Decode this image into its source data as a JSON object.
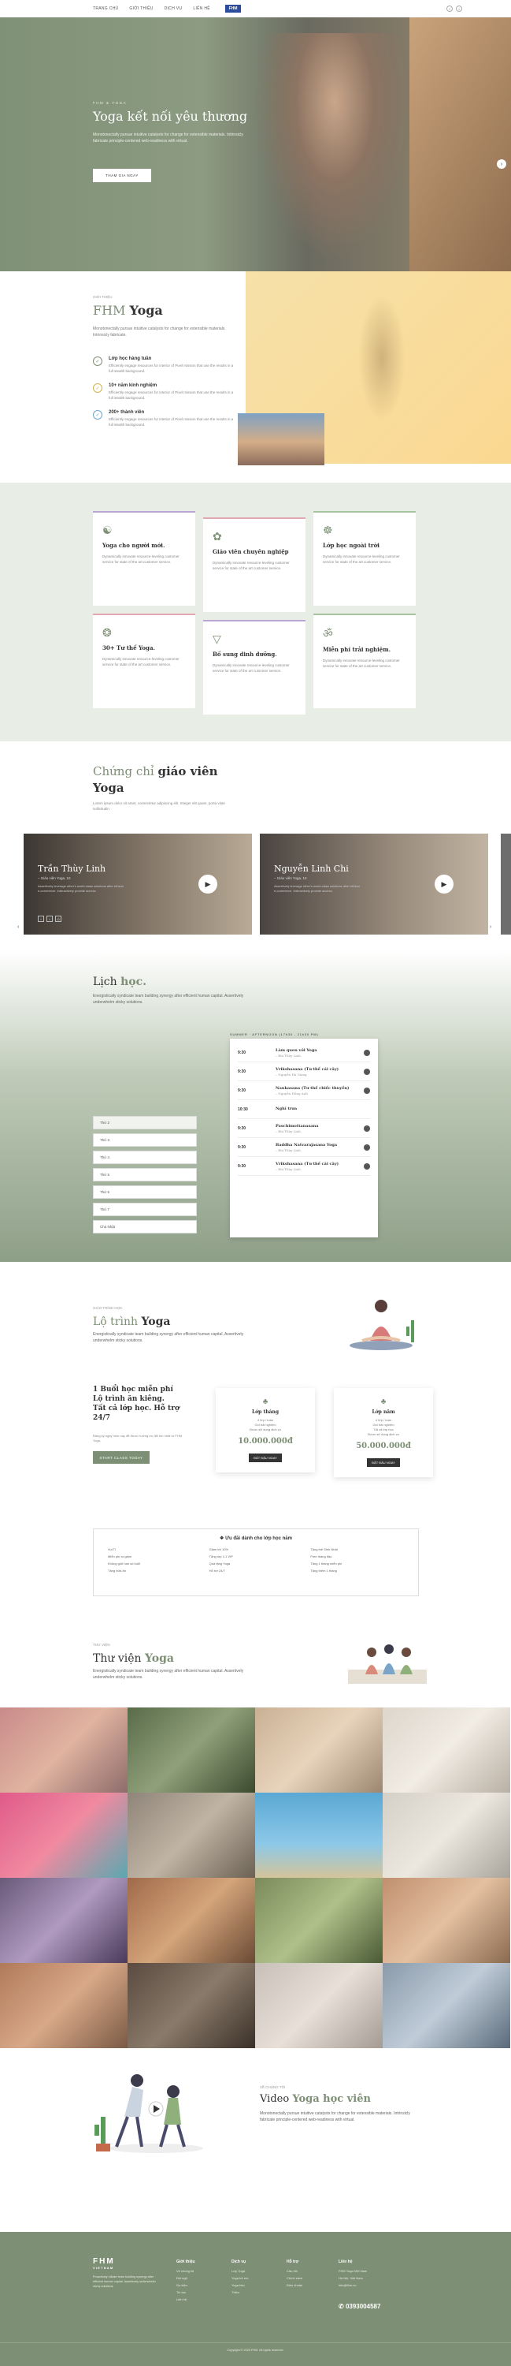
{
  "nav": {
    "links": [
      "TRANG CHỦ",
      "GIỚI THIỆU",
      "DỊCH VỤ",
      "LIÊN HỆ"
    ],
    "logo": "FHM",
    "social": [
      "f",
      "t"
    ]
  },
  "hero": {
    "kicker": "FHM & YOGA",
    "title": "Yoga kết nối yêu thương",
    "text": "Monotonectally pursue intuitive catalysts for change for extensible materials. Intrinsicly fabricate principle-centered web-readiness with virtual.",
    "button": "THAM GIA NGAY"
  },
  "about": {
    "tag": "GIỚI THIỆU",
    "title_a": "FHM",
    "title_b": "Yoga",
    "lead": "Monotonectally pursue intuitive catalysts for change for extensible materials. Intrinsicly fabricate.",
    "features": [
      {
        "icon": "✓",
        "title": "Lớp học hàng tuần",
        "text": "Efficiently engage resources for interior of Pixel mission that use the results in a full stealth background."
      },
      {
        "icon": "✓",
        "title": "10+ năm kinh nghiệm",
        "text": "Efficiently engage resources for interior of Pixel mission that use the results in a full stealth background."
      },
      {
        "icon": "✓",
        "title": "200+ thành viên",
        "text": "Efficiently engage resources for interior of Pixel mission that use the results in a full stealth background."
      }
    ]
  },
  "services": [
    {
      "icon": "☯",
      "title": "Yoga cho người mới.",
      "text": "Dynamically innovate resource-leveling customer service for state of the art customer service."
    },
    {
      "icon": "✿",
      "title": "Giáo viên chuyên nghiệp",
      "text": "Dynamically innovate resource-leveling customer service for state of the art customer service."
    },
    {
      "icon": "☸",
      "title": "Lớp học ngoài trời",
      "text": "Dynamically innovate resource-leveling customer service for state of the art customer service."
    },
    {
      "icon": "❂",
      "title": "30+ Tư thế Yoga.",
      "text": "Dynamically innovate resource-leveling customer service for state of the art customer service."
    },
    {
      "icon": "▽",
      "title": "Bố sung dinh dưỡng.",
      "text": "Dynamically innovate resource-leveling customer service for state of the art customer service."
    },
    {
      "icon": "ॐ",
      "title": "Miễn phí trải nghiệm.",
      "text": "Dynamically innovate resource-leveling customer service for state of the art customer service."
    }
  ],
  "teachers": {
    "title_a": "Chứng chỉ",
    "title_b": "giáo viên",
    "title_c": "Yoga",
    "lead": "Lorem ipsum dolor sit amet, consectetur adipiscing elit. Integer elit quam, porta vitae sollicitudin.",
    "items": [
      {
        "name": "Trần Thùy Linh",
        "role": "– Giáo viên Yoga, 10",
        "text": "Assertively leverage other's world-class solutions after ethical e-commerce. Interactively provide access."
      },
      {
        "name": "Nguyễn Linh Chi",
        "role": "– Giáo viên Yoga, 10",
        "text": "Assertively leverage other's world-class solutions after ethical e-commerce. Interactively provide access."
      }
    ]
  },
  "schedule": {
    "title_a": "Lịch",
    "title_b": "học.",
    "lead": "Energistically syndicate team building synergy after efficient human capital. Assertively underwhelm sticky solutions.",
    "table_label": "SUMMER · AFTERNOON (17h30 - 21h30 PM)",
    "days": [
      "Thứ 2",
      "Thứ 3",
      "Thứ 4",
      "Thứ 5",
      "Thứ 6",
      "Thứ 7",
      "Chủ Nhật"
    ],
    "rows": [
      {
        "time": "9:30",
        "name": "Làm quen với Yoga",
        "sub": "– Bùi Thùy Linh"
      },
      {
        "time": "9:30",
        "name": "Vrikshasana (Tư thế cái cây)",
        "sub": "– Nguyễn Hà Giang"
      },
      {
        "time": "9:30",
        "name": "Naukasana (Tư thế chiếc thuyền)",
        "sub": "– Nguyễn Hồng Anh"
      },
      {
        "time": "10:30",
        "name": "Nghỉ trưa",
        "sub": ""
      },
      {
        "time": "9:30",
        "name": "Paschimottanasana",
        "sub": "– Bùi Thùy Linh"
      },
      {
        "time": "9:30",
        "name": "Baddha Natvarajasana Yoga",
        "sub": "– Bùi Thùy Linh"
      },
      {
        "time": "9:30",
        "name": "Vrikshasana (Tư thế cái cây)",
        "sub": "– Bùi Thùy Linh"
      }
    ]
  },
  "route": {
    "tag": "GIÁO TRÌNH HỌC",
    "title_a": "Lộ trình",
    "title_b": "Yoga",
    "lead": "Energistically syndicate team building synergy after efficient human capital. Assertively underwhelm sticky solutions.",
    "promo": "1 Buổi học miễn phí Lộ trình ăn kiêng. Tất cả lớp học. Hỗ trợ 24/7",
    "small": "Đăng ký ngay hôm nay để được hưởng ưu đãi lớn nhất từ FHM Yoga.",
    "cta": "START CLASS TODAY",
    "plans": [
      {
        "icon": "♣",
        "name": "Lớp tháng",
        "features": [
          "4 lớp / tuần",
          "Gói trải nghiệm",
          "Được sử dụng dịch vụ"
        ],
        "price": "10.000.000đ",
        "button": "ĐĂT ĐẶU NGAY"
      },
      {
        "icon": "♣",
        "name": "Lớp năm",
        "features": [
          "4 lớp / tuần",
          "Gói trải nghiệm",
          "Tất cả lớp học",
          "Được sử dụng dịch vụ"
        ],
        "price": "50.000.000đ",
        "button": "ĐẶT ĐẦU NGAY"
      }
    ],
    "benefits_title": "Ưu đãi dành cho lớp học năm",
    "benefits": [
      "Vui Tí",
      "Giảm tới 10%",
      "Tặng thẻ Sinh Nhật",
      "Miễn phí tự giảm",
      "Tặng lớp 1:1 VIP",
      "Free tháng đầu",
      "Không giới hạn số buổi",
      "Quà tặng Yoga",
      "Tặng 1 tháng miễn phí",
      "Tặng bữa ăn",
      "Hỗ trợ 24/7",
      "Tặng thêm 1 tháng"
    ]
  },
  "gallery": {
    "tag": "THƯ VIỆN",
    "title_a": "Thư viện",
    "title_b": "Yoga",
    "lead": "Energistically syndicate team building synergy after efficient human capital. Assertively underwhelm sticky solutions."
  },
  "video": {
    "tag": "VỀ CHÚNG TÔI",
    "title_a": "Video",
    "title_b": "Yoga học viên",
    "text": "Monotonectally pursue intuitive catalysts for change for extensible materials. Intrinsicly fabricate principle-centered web-readiness with virtual."
  },
  "footer": {
    "logo": "FHM",
    "logo_sub": "VIETNAM",
    "desc": "Proactively initiate team building synergy after efficient human capital. Assertively underwhelm sticky solutions.",
    "cols": [
      {
        "title": "Giới thiệu",
        "items": [
          "Về chúng tôi",
          "Đội ngũ",
          "Sự kiện",
          "Tin tức",
          "Liên hệ"
        ]
      },
      {
        "title": "Dịch vụ",
        "items": [
          "Lớp Yoga",
          "Yoga trẻ em",
          "Yoga bầu",
          "Thiền"
        ]
      },
      {
        "title": "Hỗ trợ",
        "items": [
          "Câu hỏi",
          "Chính sách",
          "Điều khoản"
        ]
      },
      {
        "title": "Liên hệ",
        "items": [
          "FHM Yoga Việt Nam",
          "Hà Nội, Việt Nam",
          "info@fhm.vn"
        ]
      }
    ],
    "phone": "0393004587",
    "copy": "Copyright © 2020 FHM. All rights reserved."
  }
}
